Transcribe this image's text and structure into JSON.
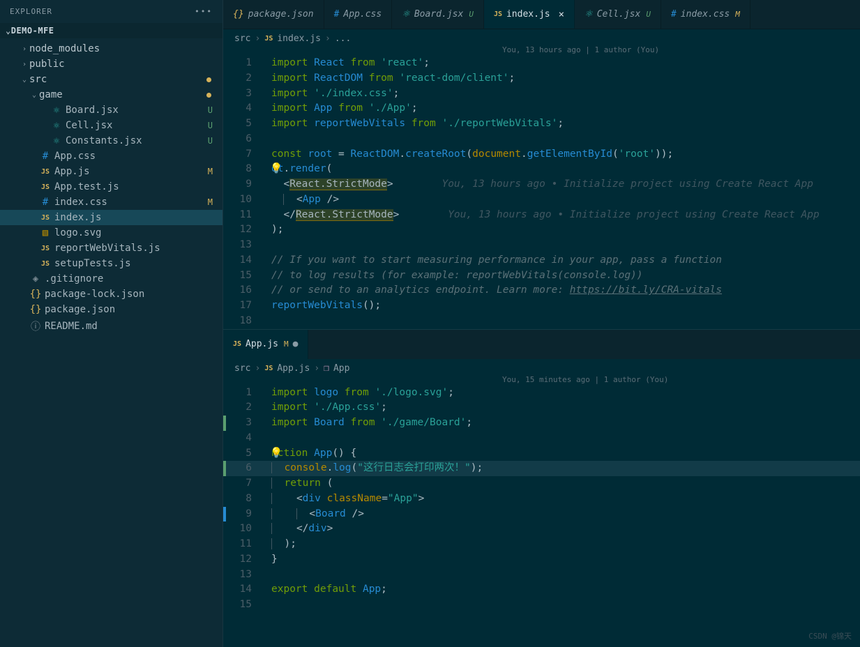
{
  "explorer": {
    "title": "EXPLORER",
    "project": "DEMO-MFE"
  },
  "tree": [
    {
      "type": "folder",
      "name": "node_modules",
      "indent": 1,
      "open": false
    },
    {
      "type": "folder",
      "name": "public",
      "indent": 1,
      "open": false
    },
    {
      "type": "folder",
      "name": "src",
      "indent": 1,
      "open": true,
      "dot": true
    },
    {
      "type": "folder",
      "name": "game",
      "indent": 2,
      "open": true,
      "dot": true
    },
    {
      "type": "file",
      "name": "Board.jsx",
      "icon": "react",
      "indent": 3,
      "badge": "U"
    },
    {
      "type": "file",
      "name": "Cell.jsx",
      "icon": "react",
      "indent": 3,
      "badge": "U"
    },
    {
      "type": "file",
      "name": "Constants.jsx",
      "icon": "react",
      "indent": 3,
      "badge": "U"
    },
    {
      "type": "file",
      "name": "App.css",
      "icon": "css",
      "indent": 2
    },
    {
      "type": "file",
      "name": "App.js",
      "icon": "js",
      "indent": 2,
      "badge": "M"
    },
    {
      "type": "file",
      "name": "App.test.js",
      "icon": "js",
      "indent": 2
    },
    {
      "type": "file",
      "name": "index.css",
      "icon": "css",
      "indent": 2,
      "badge": "M"
    },
    {
      "type": "file",
      "name": "index.js",
      "icon": "js",
      "indent": 2,
      "selected": true
    },
    {
      "type": "file",
      "name": "logo.svg",
      "icon": "svg",
      "indent": 2
    },
    {
      "type": "file",
      "name": "reportWebVitals.js",
      "icon": "js",
      "indent": 2
    },
    {
      "type": "file",
      "name": "setupTests.js",
      "icon": "js",
      "indent": 2
    },
    {
      "type": "file",
      "name": ".gitignore",
      "icon": "git",
      "indent": 1
    },
    {
      "type": "file",
      "name": "package-lock.json",
      "icon": "json",
      "indent": 1
    },
    {
      "type": "file",
      "name": "package.json",
      "icon": "json",
      "indent": 1
    },
    {
      "type": "file",
      "name": "README.md",
      "icon": "info",
      "indent": 1
    }
  ],
  "tabs": [
    {
      "label": "package.json",
      "icon": "json"
    },
    {
      "label": "App.css",
      "icon": "css"
    },
    {
      "label": "Board.jsx",
      "icon": "react",
      "badge": "U"
    },
    {
      "label": "index.js",
      "icon": "js",
      "active": true,
      "close": true
    },
    {
      "label": "Cell.jsx",
      "icon": "react",
      "badge": "U"
    },
    {
      "label": "index.css",
      "icon": "css",
      "badge": "M"
    }
  ],
  "pane1": {
    "breadcrumb": [
      "src",
      "index.js",
      "..."
    ],
    "codelens": "You, 13 hours ago | 1 author (You)",
    "gitlens_text": "You, 13 hours ago • Initialize project using Create React App",
    "link": "https://bit.ly/CRA-vitals",
    "lines": 18
  },
  "pane2": {
    "tab": {
      "label": "App.js",
      "icon": "js",
      "badge": "M",
      "dirty": true
    },
    "breadcrumb": [
      "src",
      "App.js",
      "App"
    ],
    "codelens": "You, 15 minutes ago | 1 author (You)",
    "lines": 15,
    "log_string": "\"这行日志会打印两次！\""
  },
  "watermark": "CSDN @锦天"
}
